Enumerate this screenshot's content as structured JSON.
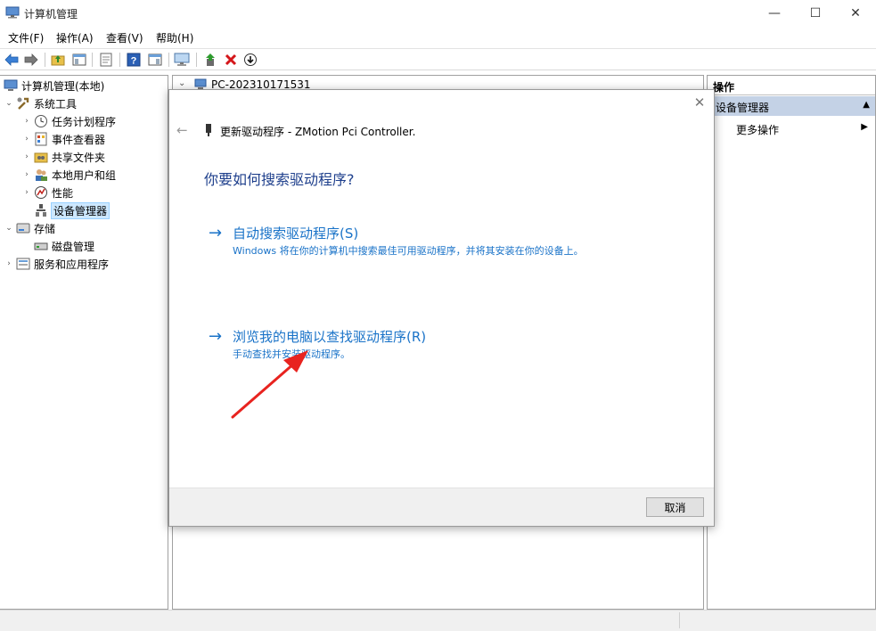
{
  "window": {
    "title": "计算机管理",
    "minimize_glyph": "—",
    "maximize_glyph": "☐",
    "close_glyph": "✕"
  },
  "menu": {
    "items": [
      "文件(F)",
      "操作(A)",
      "查看(V)",
      "帮助(H)"
    ]
  },
  "toolbar": {
    "icons": [
      "back-arrow-icon",
      "forward-arrow-icon",
      "up-folder-icon",
      "show-hide-tree-icon",
      "properties-icon",
      "help-icon",
      "show-action-pane-icon",
      "monitor-icon",
      "update-driver-icon",
      "uninstall-icon",
      "download-icon"
    ]
  },
  "tree": {
    "root": "计算机管理(本地)",
    "system_tools": "系统工具",
    "task_scheduler": "任务计划程序",
    "event_viewer": "事件查看器",
    "shared_folders": "共享文件夹",
    "local_users": "本地用户和组",
    "performance": "性能",
    "device_manager": "设备管理器",
    "storage": "存储",
    "disk_management": "磁盘管理",
    "services_apps": "服务和应用程序"
  },
  "center": {
    "computer_name": "PC-202310171531"
  },
  "actions": {
    "title": "操作",
    "section": "设备管理器",
    "more": "更多操作"
  },
  "dialog": {
    "title": "更新驱动程序 - ZMotion Pci Controller.",
    "question": "你要如何搜索驱动程序?",
    "option_auto": {
      "label": "自动搜索驱动程序(S)",
      "desc": "Windows 将在你的计算机中搜索最佳可用驱动程序，并将其安装在你的设备上。"
    },
    "option_browse": {
      "label": "浏览我的电脑以查找驱动程序(R)",
      "desc": "手动查找并安装驱动程序。"
    },
    "cancel": "取消",
    "arrow_glyph": "→",
    "back_glyph": "←",
    "close_glyph": "✕"
  },
  "colors": {
    "link_blue": "#1a73c8",
    "heading_blue": "#1e3f8c",
    "annotation_red": "#e8231f",
    "selection": "#cde8ff",
    "action_header": "#c4d2e6"
  }
}
